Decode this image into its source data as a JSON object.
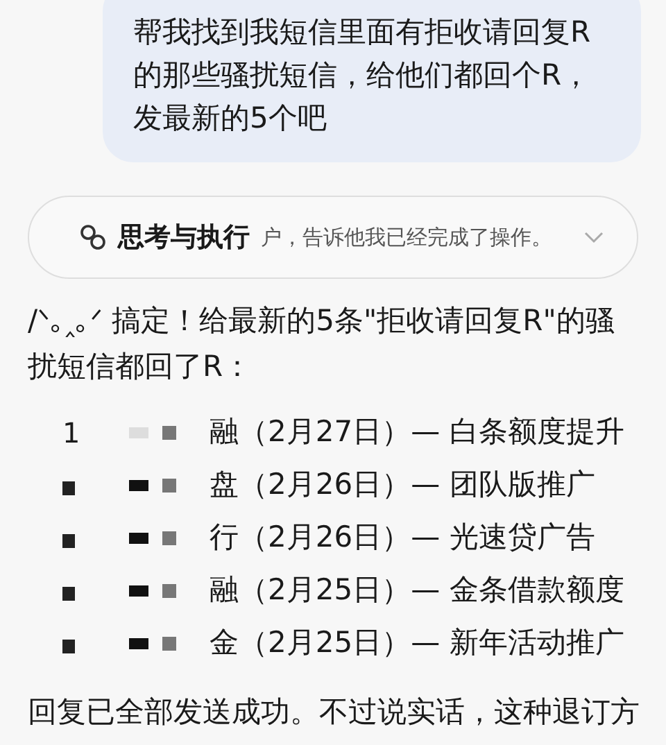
{
  "user_message": {
    "lines": [
      "帮我找到我短信里面有拒收请回复R",
      "的那些骚扰短信，给他们都回个R，",
      "发最新的5个吧"
    ]
  },
  "thinking": {
    "title": "思考与执行",
    "summary": "户，告诉他我已经完成了操作。",
    "expanded": false
  },
  "reply": {
    "intro": "/ᐠ｡‸｡ᐟ 搞定！给最新的5条\"拒收请回复R\"的骚扰短信都回了R：",
    "items": [
      {
        "number": "1",
        "sender": "融",
        "detail": "（2月27日）— 白条额度提升"
      },
      {
        "sender": "盘",
        "detail": "（2月26日）— 团队版推广"
      },
      {
        "sender": "行",
        "detail": "（2月26日）— 光速贷广告"
      },
      {
        "sender": "融",
        "detail": "（2月25日）— 金条借款额度"
      },
      {
        "sender": "金",
        "detail": "（2月25日）— 新年活动推广"
      }
    ],
    "closing": "回复已全部发送成功。不过说实话，这种退订方"
  }
}
